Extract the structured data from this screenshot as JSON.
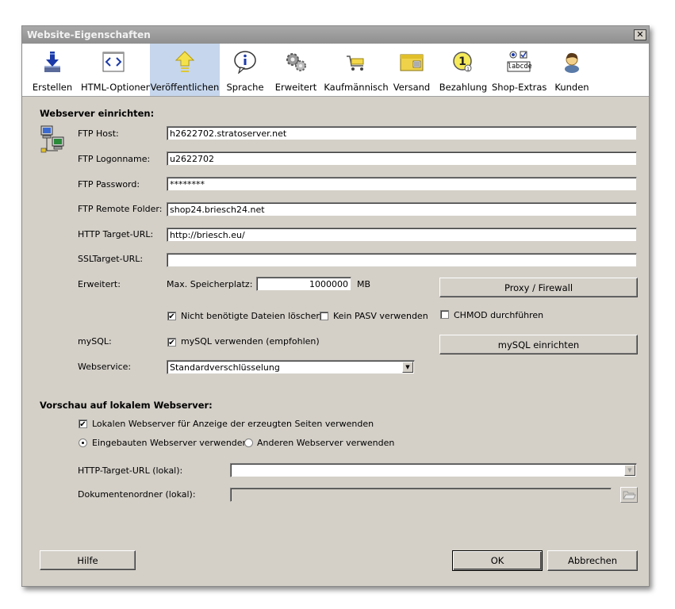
{
  "window": {
    "title": "Website-Eigenschaften",
    "close_glyph": "✕"
  },
  "toolbar": {
    "items": [
      {
        "label": "Erstellen",
        "icon": "download-arrow-icon"
      },
      {
        "label": "HTML-Optionen",
        "icon": "html-code-icon"
      },
      {
        "label": "Veröffentlichen",
        "icon": "upload-arrow-icon",
        "active": true
      },
      {
        "label": "Sprache",
        "icon": "info-bubble-icon"
      },
      {
        "label": "Erweitert",
        "icon": "gears-icon"
      },
      {
        "label": "Kaufmännisch",
        "icon": "shopping-cart-icon"
      },
      {
        "label": "Versand",
        "icon": "package-icon"
      },
      {
        "label": "Bezahlung",
        "icon": "coin-icon"
      },
      {
        "label": "Shop-Extras",
        "icon": "form-controls-icon",
        "icon_text": "labcde"
      },
      {
        "label": "Kunden",
        "icon": "customer-icon"
      }
    ],
    "active_color": "#c6d6ec"
  },
  "webserver": {
    "heading": "Webserver einrichten:",
    "ftp_host_label": "FTP Host:",
    "ftp_host_value": "h2622702.stratoserver.net",
    "ftp_logon_label": "FTP Logonname:",
    "ftp_logon_value": "u2622702",
    "ftp_password_label": "FTP Password:",
    "ftp_password_value": "********",
    "ftp_folder_label": "FTP Remote Folder:",
    "ftp_folder_value": "shop24.briesch24.net",
    "http_target_label": "HTTP Target-URL:",
    "http_target_value": "http://briesch.eu/",
    "ssl_target_label": "SSLTarget-URL:",
    "ssl_target_value": "",
    "erweitert_label": "Erweitert:",
    "max_storage_label": "Max. Speicherplatz:",
    "max_storage_value": "1000000",
    "max_storage_unit": "MB",
    "proxy_button": "Proxy / Firewall",
    "delete_unneeded_label": "Nicht benötigte Dateien löschen",
    "delete_unneeded_checked": "✔",
    "no_pasv_label": "Kein PASV verwenden",
    "chmod_label": "CHMOD durchführen",
    "mysql_label": "mySQL:",
    "mysql_use_label": "mySQL verwenden (empfohlen)",
    "mysql_use_checked": "✔",
    "mysql_setup_button": "mySQL einrichten",
    "webservice_label": "Webservice:",
    "webservice_value": "Standardverschlüsselung",
    "dropdown_arrow": "▼"
  },
  "preview": {
    "heading": "Vorschau auf lokalem Webserver:",
    "use_local_label": "Lokalen Webserver für Anzeige der erzeugten Seiten verwenden",
    "use_local_checked": "✔",
    "builtin_label": "Eingebauten Webserver verwenden",
    "other_label": "Anderen Webserver verwenden",
    "http_local_label": "HTTP-Target-URL (lokal):",
    "http_local_value": "",
    "doc_folder_label": "Dokumentenordner (lokal):",
    "doc_folder_value": ""
  },
  "footer": {
    "help_button": "Hilfe",
    "ok_button": "OK",
    "cancel_button": "Abbrechen"
  }
}
